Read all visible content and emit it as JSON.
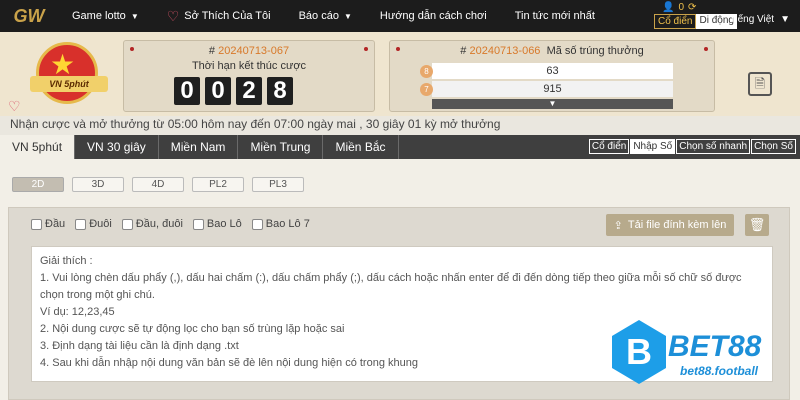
{
  "nav": {
    "logo": "GW",
    "items": [
      {
        "label": "Game lotto",
        "chevron": true
      },
      {
        "label": "Sở Thích Của Tôi",
        "icon": "heart-icon"
      },
      {
        "label": "Báo cáo",
        "chevron": true
      },
      {
        "label": "Hướng dẫn cách chơi"
      },
      {
        "label": "Tin tức mới nhất"
      }
    ],
    "balance": "0",
    "mode_classic": "Cổ điển",
    "mode_mobile": "Di động",
    "language": "Tiếng Việt"
  },
  "badge_text": "VN 5phút",
  "countdown": {
    "issue_prefix": "#",
    "issue": "20240713-067",
    "label": "Thời hạn kết thúc cược",
    "digits": [
      "0",
      "0",
      "2",
      "8"
    ]
  },
  "results": {
    "issue_prefix": "#",
    "issue": "20240713-066",
    "label": "Mã số trúng thưởng",
    "rows": [
      {
        "ball": "8",
        "value": "63"
      },
      {
        "ball": "7",
        "value": "915"
      }
    ]
  },
  "notice": "Nhận cược và mở thưởng từ 05:00 hôm nay đến 07:00 ngày mai ,  30 giây 01 kỳ mở thưởng",
  "tabs": [
    "VN 5phút",
    "VN 30 giây",
    "Miền Nam",
    "Miền Trung",
    "Miền Bắc"
  ],
  "entry_modes": [
    "Cổ điển",
    "Nhập Số",
    "Chọn số nhanh",
    "Chọn Số"
  ],
  "subtabs": [
    "2D",
    "3D",
    "4D",
    "PL2",
    "PL3"
  ],
  "checks": [
    "Đầu",
    "Đuôi",
    "Đầu, đuôi",
    "Bao Lô",
    "Bao Lô 7"
  ],
  "upload_label": "Tải file đính kèm lên",
  "instructions": [
    "Giải thích :",
    "1. Vui lòng chèn dấu phẩy (,), dấu hai chấm (:), dấu chấm phẩy (;), dấu cách hoặc nhấn enter để đi đến dòng tiếp theo giữa mỗi số chữ số được chọn trong một ghi chú.",
    "Ví dụ: 12,23,45",
    "2. Nội dung cược sẽ tự động lọc cho bạn số trùng lặp hoặc sai",
    "3. Định dạng tài liệu cần là định dạng .txt",
    "4. Sau khi dẫn nhập nội dung văn bản sẽ đè lên nội dung hiện có trong khung"
  ],
  "watermark": {
    "brand": "BET88",
    "site": "bet88.football"
  }
}
